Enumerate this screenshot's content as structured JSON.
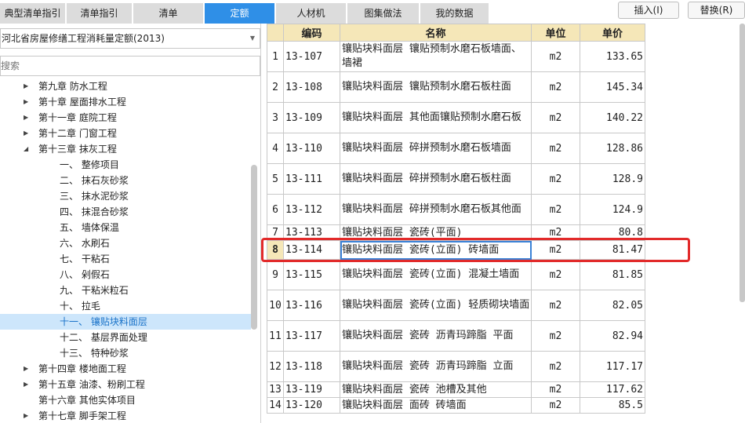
{
  "tabs": [
    {
      "label": "典型清单指引",
      "active": false
    },
    {
      "label": "清单指引",
      "active": false
    },
    {
      "label": "清单",
      "active": false
    },
    {
      "label": "定额",
      "active": true
    },
    {
      "label": "人材机",
      "active": false
    },
    {
      "label": "图集做法",
      "active": false
    },
    {
      "label": "我的数据",
      "active": false
    }
  ],
  "buttons": {
    "insert": "插入(I)",
    "replace": "替换(R)"
  },
  "quota_library": "河北省房屋修缮工程消耗量定额(2013)",
  "search_placeholder": "搜索",
  "tree": [
    {
      "label": "第九章 防水工程",
      "level": 1,
      "arrow": "collapsed"
    },
    {
      "label": "第十章 屋面排水工程",
      "level": 1,
      "arrow": "collapsed"
    },
    {
      "label": "第十一章 庭院工程",
      "level": 1,
      "arrow": "collapsed"
    },
    {
      "label": "第十二章 门窗工程",
      "level": 1,
      "arrow": "collapsed"
    },
    {
      "label": "第十三章 抹灰工程",
      "level": 1,
      "arrow": "expanded"
    },
    {
      "label": "一、 整修项目",
      "level": 2
    },
    {
      "label": "二、 抹石灰砂浆",
      "level": 2
    },
    {
      "label": "三、 抹水泥砂浆",
      "level": 2
    },
    {
      "label": "四、 抹混合砂浆",
      "level": 2
    },
    {
      "label": "五、 墙体保温",
      "level": 2
    },
    {
      "label": "六、 水刷石",
      "level": 2
    },
    {
      "label": "七、 干粘石",
      "level": 2
    },
    {
      "label": "八、 剁假石",
      "level": 2
    },
    {
      "label": "九、 干粘米粒石",
      "level": 2
    },
    {
      "label": "十、 拉毛",
      "level": 2
    },
    {
      "label": "十一、 镶贴块料面层",
      "level": 2,
      "selected": true
    },
    {
      "label": "十二、 基层界面处理",
      "level": 2
    },
    {
      "label": "十三、 特种砂浆",
      "level": 2
    },
    {
      "label": "第十四章 楼地面工程",
      "level": 1,
      "arrow": "collapsed"
    },
    {
      "label": "第十五章 油漆、粉刷工程",
      "level": 1,
      "arrow": "collapsed"
    },
    {
      "label": "第十六章 其他实体项目",
      "level": 1,
      "arrow": "none"
    },
    {
      "label": "第十七章 脚手架工程",
      "level": 1,
      "arrow": "collapsed"
    }
  ],
  "table": {
    "headers": [
      "",
      "编码",
      "名称",
      "单位",
      "单价"
    ],
    "rows": [
      {
        "num": "1",
        "code": "13-107",
        "name": "镶贴块料面层 镶贴预制水磨石板墙面、墙裙",
        "unit": "m2",
        "price": "133.65"
      },
      {
        "num": "2",
        "code": "13-108",
        "name": "镶贴块料面层 镶贴预制水磨石板柱面",
        "unit": "m2",
        "price": "145.34"
      },
      {
        "num": "3",
        "code": "13-109",
        "name": "镶贴块料面层 其他面镶贴预制水磨石板",
        "unit": "m2",
        "price": "140.22"
      },
      {
        "num": "4",
        "code": "13-110",
        "name": "镶贴块料面层 碎拼预制水磨石板墙面",
        "unit": "m2",
        "price": "128.86"
      },
      {
        "num": "5",
        "code": "13-111",
        "name": "镶贴块料面层 碎拼预制水磨石板柱面",
        "unit": "m2",
        "price": "128.9"
      },
      {
        "num": "6",
        "code": "13-112",
        "name": "镶贴块料面层 碎拼预制水磨石板其他面",
        "unit": "m2",
        "price": "124.9"
      },
      {
        "num": "7",
        "code": "13-113",
        "name": "镶贴块料面层 瓷砖(平面)",
        "unit": "m2",
        "price": "80.8",
        "short": true
      },
      {
        "num": "8",
        "code": "13-114",
        "name": "镶贴块料面层 瓷砖(立面) 砖墙面",
        "unit": "m2",
        "price": "81.47",
        "current": true
      },
      {
        "num": "9",
        "code": "13-115",
        "name": "镶贴块料面层 瓷砖(立面) 混凝土墙面",
        "unit": "m2",
        "price": "81.85"
      },
      {
        "num": "10",
        "code": "13-116",
        "name": "镶贴块料面层 瓷砖(立面) 轻质砌块墙面",
        "unit": "m2",
        "price": "82.05"
      },
      {
        "num": "11",
        "code": "13-117",
        "name": "镶贴块料面层 瓷砖 沥青玛蹄脂 平面",
        "unit": "m2",
        "price": "82.94"
      },
      {
        "num": "12",
        "code": "13-118",
        "name": "镶贴块料面层 瓷砖 沥青玛蹄脂 立面",
        "unit": "m2",
        "price": "117.17"
      },
      {
        "num": "13",
        "code": "13-119",
        "name": "镶贴块料面层 瓷砖 池槽及其他",
        "unit": "m2",
        "price": "117.62",
        "short": true
      },
      {
        "num": "14",
        "code": "13-120",
        "name": "镶贴块料面层 面砖 砖墙面",
        "unit": "m2",
        "price": "85.5",
        "short": true
      }
    ]
  }
}
